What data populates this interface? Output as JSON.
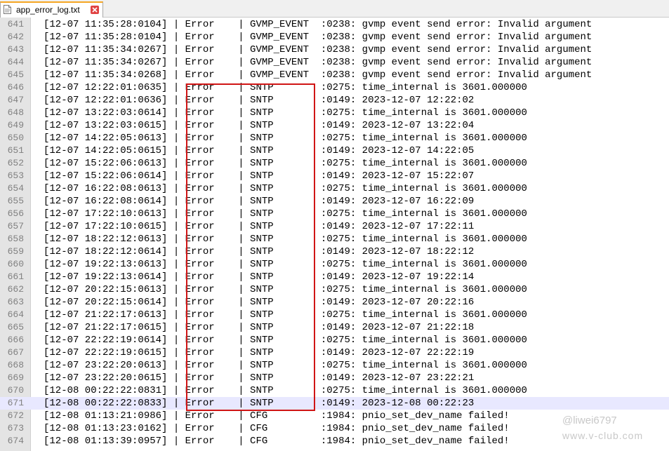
{
  "tab": {
    "title": "app_error_log.txt",
    "close_icon": "close-icon",
    "file_icon": "text-file-icon"
  },
  "colors": {
    "highlight_box": "#d01515",
    "current_line": "#e8e8ff",
    "tab_accent": "#f5a623"
  },
  "lines": [
    {
      "num": "641",
      "text": "[12-07 11:35:28:0104] | Error    | GVMP_EVENT  :0238: gvmp event send error: Invalid argument"
    },
    {
      "num": "642",
      "text": "[12-07 11:35:28:0104] | Error    | GVMP_EVENT  :0238: gvmp event send error: Invalid argument"
    },
    {
      "num": "643",
      "text": "[12-07 11:35:34:0267] | Error    | GVMP_EVENT  :0238: gvmp event send error: Invalid argument"
    },
    {
      "num": "644",
      "text": "[12-07 11:35:34:0267] | Error    | GVMP_EVENT  :0238: gvmp event send error: Invalid argument"
    },
    {
      "num": "645",
      "text": "[12-07 11:35:34:0268] | Error    | GVMP_EVENT  :0238: gvmp event send error: Invalid argument"
    },
    {
      "num": "646",
      "text": "[12-07 12:22:01:0635] | Error    | SNTP        :0275: time_internal is 3601.000000"
    },
    {
      "num": "647",
      "text": "[12-07 12:22:01:0636] | Error    | SNTP        :0149: 2023-12-07 12:22:02"
    },
    {
      "num": "648",
      "text": "[12-07 13:22:03:0614] | Error    | SNTP        :0275: time_internal is 3601.000000"
    },
    {
      "num": "649",
      "text": "[12-07 13:22:03:0615] | Error    | SNTP        :0149: 2023-12-07 13:22:04"
    },
    {
      "num": "650",
      "text": "[12-07 14:22:05:0613] | Error    | SNTP        :0275: time_internal is 3601.000000"
    },
    {
      "num": "651",
      "text": "[12-07 14:22:05:0615] | Error    | SNTP        :0149: 2023-12-07 14:22:05"
    },
    {
      "num": "652",
      "text": "[12-07 15:22:06:0613] | Error    | SNTP        :0275: time_internal is 3601.000000"
    },
    {
      "num": "653",
      "text": "[12-07 15:22:06:0614] | Error    | SNTP        :0149: 2023-12-07 15:22:07"
    },
    {
      "num": "654",
      "text": "[12-07 16:22:08:0613] | Error    | SNTP        :0275: time_internal is 3601.000000"
    },
    {
      "num": "655",
      "text": "[12-07 16:22:08:0614] | Error    | SNTP        :0149: 2023-12-07 16:22:09"
    },
    {
      "num": "656",
      "text": "[12-07 17:22:10:0613] | Error    | SNTP        :0275: time_internal is 3601.000000"
    },
    {
      "num": "657",
      "text": "[12-07 17:22:10:0615] | Error    | SNTP        :0149: 2023-12-07 17:22:11"
    },
    {
      "num": "658",
      "text": "[12-07 18:22:12:0613] | Error    | SNTP        :0275: time_internal is 3601.000000"
    },
    {
      "num": "659",
      "text": "[12-07 18:22:12:0614] | Error    | SNTP        :0149: 2023-12-07 18:22:12"
    },
    {
      "num": "660",
      "text": "[12-07 19:22:13:0613] | Error    | SNTP        :0275: time_internal is 3601.000000"
    },
    {
      "num": "661",
      "text": "[12-07 19:22:13:0614] | Error    | SNTP        :0149: 2023-12-07 19:22:14"
    },
    {
      "num": "662",
      "text": "[12-07 20:22:15:0613] | Error    | SNTP        :0275: time_internal is 3601.000000"
    },
    {
      "num": "663",
      "text": "[12-07 20:22:15:0614] | Error    | SNTP        :0149: 2023-12-07 20:22:16"
    },
    {
      "num": "664",
      "text": "[12-07 21:22:17:0613] | Error    | SNTP        :0275: time_internal is 3601.000000"
    },
    {
      "num": "665",
      "text": "[12-07 21:22:17:0615] | Error    | SNTP        :0149: 2023-12-07 21:22:18"
    },
    {
      "num": "666",
      "text": "[12-07 22:22:19:0614] | Error    | SNTP        :0275: time_internal is 3601.000000"
    },
    {
      "num": "667",
      "text": "[12-07 22:22:19:0615] | Error    | SNTP        :0149: 2023-12-07 22:22:19"
    },
    {
      "num": "668",
      "text": "[12-07 23:22:20:0613] | Error    | SNTP        :0275: time_internal is 3601.000000"
    },
    {
      "num": "669",
      "text": "[12-07 23:22:20:0615] | Error    | SNTP        :0149: 2023-12-07 23:22:21"
    },
    {
      "num": "670",
      "text": "[12-08 00:22:22:0831] | Error    | SNTP        :0275: time_internal is 3601.000000"
    },
    {
      "num": "671",
      "text": "[12-08 00:22:22:0833] | Error    | SNTP        :0149: 2023-12-08 00:22:23",
      "current": true
    },
    {
      "num": "672",
      "text": "[12-08 01:13:21:0986] | Error    | CFG         :1984: pnio_set_dev_name failed!"
    },
    {
      "num": "673",
      "text": "[12-08 01:13:23:0162] | Error    | CFG         :1984: pnio_set_dev_name failed!"
    },
    {
      "num": "674",
      "text": "[12-08 01:13:39:0957] | Error    | CFG         :1984: pnio_set_dev_name failed!"
    }
  ],
  "watermark": {
    "handle": "@liwei6797",
    "site": "www.v-club.com"
  }
}
